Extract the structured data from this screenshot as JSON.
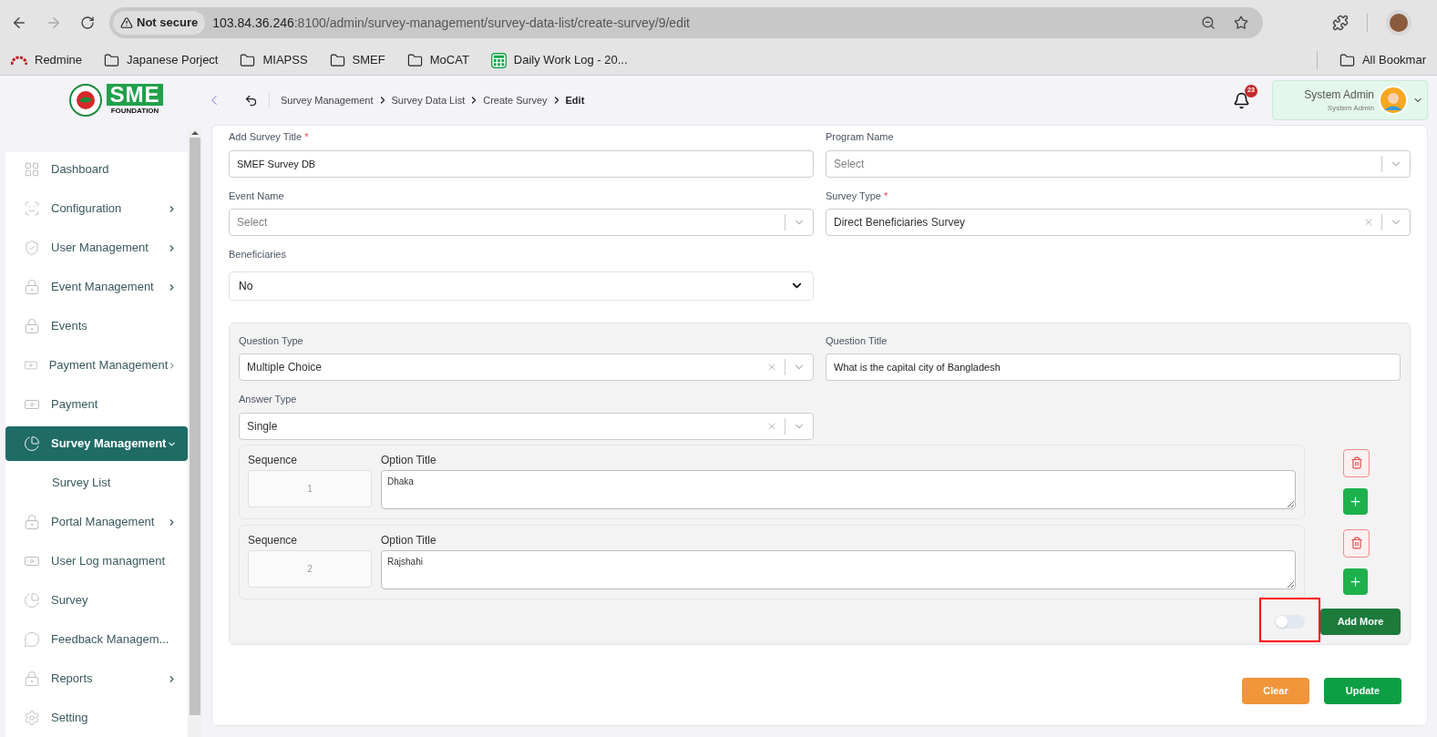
{
  "browser": {
    "security": "Not secure",
    "url_host": "103.84.36.246",
    "url_rest": ":8100/admin/survey-management/survey-data-list/create-survey/9/edit",
    "bookmarks": [
      {
        "label": "Redmine",
        "kind": "redmine"
      },
      {
        "label": "Japanese Porject",
        "kind": "folder"
      },
      {
        "label": "MIAPSS",
        "kind": "folder"
      },
      {
        "label": "SMEF",
        "kind": "folder"
      },
      {
        "label": "MoCAT",
        "kind": "folder"
      },
      {
        "label": "Daily Work Log - 20...",
        "kind": "sheet"
      }
    ],
    "all_bookmarks": "All Bookmar"
  },
  "logo": {
    "text": "SME",
    "subtitle": "FOUNDATION"
  },
  "breadcrumb": [
    {
      "label": "Survey Management",
      "current": false
    },
    {
      "label": "Survey Data List",
      "current": false
    },
    {
      "label": "Create Survey",
      "current": false
    },
    {
      "label": "Edit",
      "current": true
    }
  ],
  "notifications": {
    "count": "23"
  },
  "user": {
    "name": "System Admin",
    "role": "System Admin"
  },
  "sidebar": {
    "items": [
      {
        "label": "Dashboard",
        "kind": "grid",
        "selected": false
      },
      {
        "label": "Configuration",
        "kind": "scan",
        "expanded": false,
        "selected": false
      },
      {
        "label": "User Management",
        "kind": "shield",
        "expanded": false,
        "selected": false
      },
      {
        "label": "Event Management",
        "kind": "lock",
        "expanded": false,
        "selected": false
      },
      {
        "label": "Events",
        "kind": "lock",
        "selected": false
      },
      {
        "label": "Payment Management",
        "kind": "money",
        "expanded": false,
        "selected": false
      },
      {
        "label": "Payment",
        "kind": "money",
        "selected": false
      },
      {
        "label": "Survey Management",
        "kind": "pie",
        "expanded": true,
        "selected": true,
        "children": [
          {
            "label": "Survey List",
            "selected": false
          }
        ]
      },
      {
        "label": "Portal Management",
        "kind": "lock",
        "expanded": false,
        "selected": false
      },
      {
        "label": "User Log managment",
        "kind": "money",
        "selected": false
      },
      {
        "label": "Survey",
        "kind": "pie",
        "selected": false
      },
      {
        "label": "Feedback Managem...",
        "kind": "feedback",
        "selected": false
      },
      {
        "label": "Reports",
        "kind": "lock",
        "expanded": false,
        "selected": false
      },
      {
        "label": "Setting",
        "kind": "gear",
        "selected": false
      }
    ]
  },
  "form": {
    "fields": [
      {
        "label": "Add Survey Title",
        "required_mark": "*",
        "kind": "text",
        "value": "SMEF Survey DB"
      },
      {
        "label": "Program Name",
        "kind": "select",
        "placeholder": "Select"
      },
      {
        "label": "Event Name",
        "kind": "select",
        "placeholder": "Select"
      },
      {
        "label": "Survey Type",
        "required_mark": "*",
        "kind": "select",
        "value": "Direct Beneficiaries Survey",
        "clearable": true
      },
      {
        "label": "Beneficiaries",
        "kind": "native",
        "value": "No"
      }
    ]
  },
  "question": {
    "fields": [
      {
        "label": "Question Type",
        "kind": "select",
        "value": "Multiple Choice",
        "clearable": true
      },
      {
        "label": "Question Title",
        "kind": "text",
        "value": "What is the capital city of Bangladesh"
      },
      {
        "label": "Answer Type",
        "kind": "select",
        "value": "Single",
        "clearable": true
      }
    ],
    "options": [
      {
        "sequence_label": "Sequence",
        "sequence": "1",
        "title_label": "Option Title",
        "title": "Dhaka"
      },
      {
        "sequence_label": "Sequence",
        "sequence": "2",
        "title_label": "Option Title",
        "title": "Rajshahi"
      }
    ],
    "toggle": {
      "on": false,
      "highlighted": true
    },
    "add_more": "Add More"
  },
  "actions": [
    {
      "label": "Clear",
      "kind": "secondary"
    },
    {
      "label": "Update",
      "kind": "primary"
    }
  ]
}
